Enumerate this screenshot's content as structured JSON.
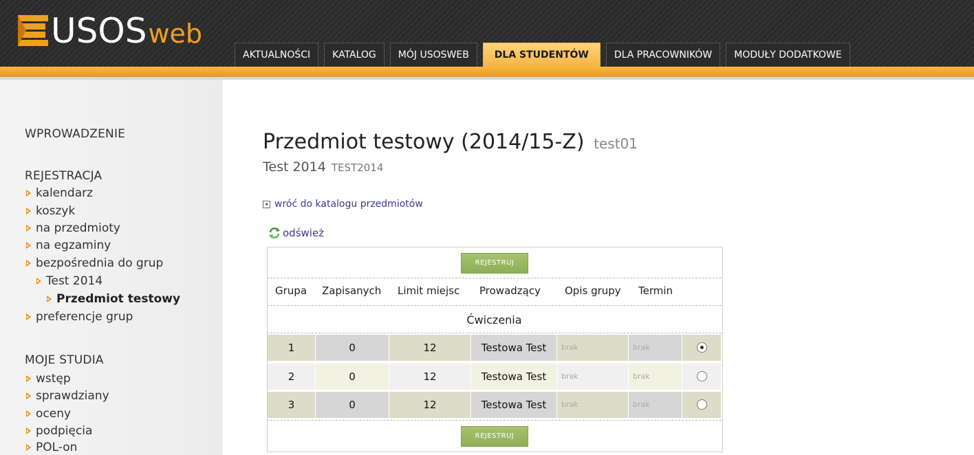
{
  "logo": {
    "brand": "USOS",
    "suffix": "web"
  },
  "nav": {
    "tabs": [
      {
        "label": "AKTUALNOŚCI",
        "active": false
      },
      {
        "label": "KATALOG",
        "active": false
      },
      {
        "label": "MÓJ USOSWEB",
        "active": false
      },
      {
        "label": "DLA STUDENTÓW",
        "active": true
      },
      {
        "label": "DLA PRACOWNIKÓW",
        "active": false
      },
      {
        "label": "MODUŁY DODATKOWE",
        "active": false
      }
    ]
  },
  "sidebar": {
    "intro": "WPROWADZENIE",
    "registration": {
      "heading": "REJESTRACJA",
      "items": [
        "kalendarz",
        "koszyk",
        "na przedmioty",
        "na egzaminy",
        "bezpośrednia do grup",
        "Test 2014",
        "Przedmiot testowy",
        "preferencje grup"
      ]
    },
    "studies": {
      "heading": "MOJE STUDIA",
      "items": [
        "wstęp",
        "sprawdziany",
        "oceny",
        "podpięcia",
        "POL-on"
      ]
    }
  },
  "main": {
    "title": "Przedmiot testowy (2014/15-Z)",
    "title_code": "test01",
    "subtitle": "Test 2014",
    "subtitle_code": "TEST2014",
    "back_link": "wróć do katalogu przedmiotów",
    "refresh": "odśwież",
    "register_button": "REJESTRUJ",
    "headers": [
      "Grupa",
      "Zapisanych",
      "Limit miejsc",
      "Prowadzący",
      "Opis grupy",
      "Termin"
    ],
    "section": "Ćwiczenia",
    "rows": [
      {
        "group": "1",
        "enrolled": "0",
        "limit": "12",
        "lecturer": "Testowa Test",
        "desc": "brak",
        "term": "brak",
        "selected": true
      },
      {
        "group": "2",
        "enrolled": "0",
        "limit": "12",
        "lecturer": "Testowa Test",
        "desc": "brak",
        "term": "brak",
        "selected": false
      },
      {
        "group": "3",
        "enrolled": "0",
        "limit": "12",
        "lecturer": "Testowa Test",
        "desc": "brak",
        "term": "brak",
        "selected": false
      }
    ]
  },
  "colors": {
    "accent": "#f5b445",
    "header_bg": "#2b2b2b",
    "button_green": "#9bb865",
    "link": "#3a3a90"
  }
}
